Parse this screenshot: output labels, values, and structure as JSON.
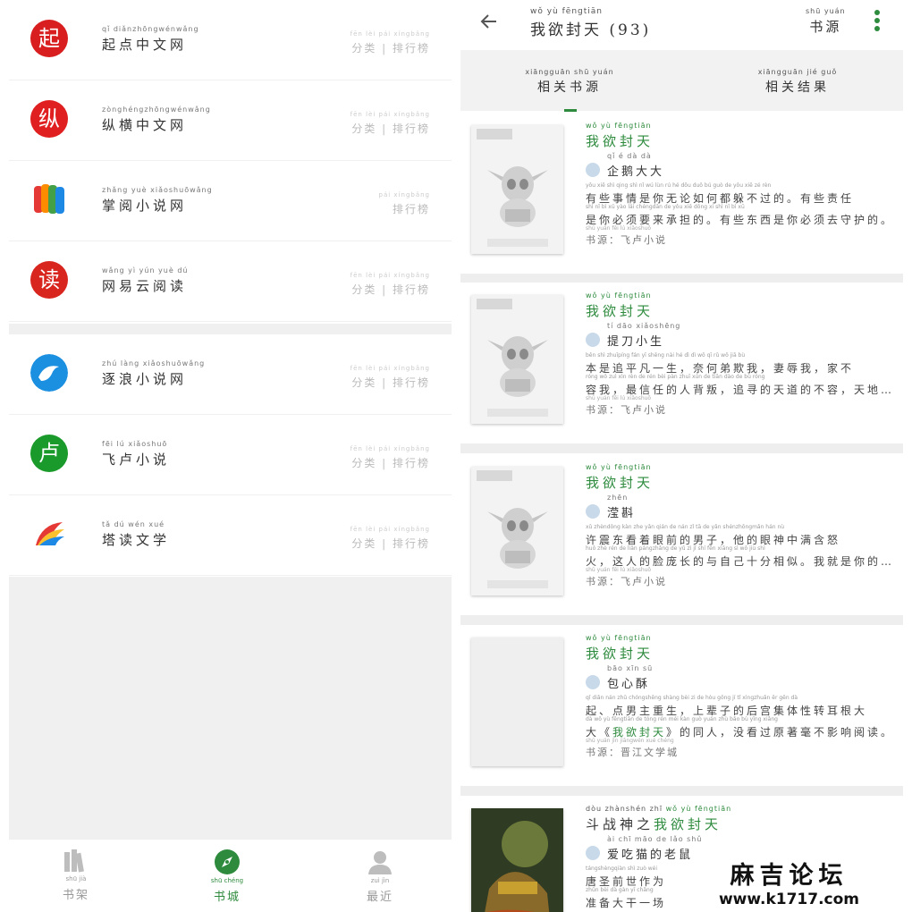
{
  "left": {
    "sources": [
      {
        "name_py": "qǐ diǎnzhōngwénwǎng",
        "name": "起点中文网",
        "links_py": "fēn lèi   pái xíngbǎng",
        "links": "分类 | 排行榜",
        "logo_color": "#d81e1e",
        "logo_glyph": "起",
        "icon": "qidian-logo-icon"
      },
      {
        "name_py": "zònghéngzhōngwénwǎng",
        "name": "纵横中文网",
        "links_py": "fēn lèi   pái xíngbǎng",
        "links": "分类 | 排行榜",
        "logo_color": "#e02020",
        "logo_glyph": "纵",
        "icon": "zongheng-logo-icon"
      },
      {
        "name_py": "zhǎng yuè xiǎoshuōwǎng",
        "name": "掌阅小说网",
        "links_py": "pái xíngbǎng",
        "links": "排行榜",
        "logo_color": "#f2b200",
        "logo_glyph": "",
        "icon": "zhangyue-logo-icon"
      },
      {
        "name_py": "wǎng yì yún yuè dú",
        "name": "网易云阅读",
        "links_py": "fēn lèi   pái xíngbǎng",
        "links": "分类 | 排行榜",
        "logo_color": "#d8261f",
        "logo_glyph": "读",
        "icon": "netease-read-logo-icon"
      },
      {
        "name_py": "zhú làng xiǎoshuōwǎng",
        "name": "逐浪小说网",
        "links_py": "fēn lèi   pái xíngbǎng",
        "links": "分类 | 排行榜",
        "logo_color": "#1b8fe0",
        "logo_glyph": "",
        "icon": "dolphin-logo-icon"
      },
      {
        "name_py": "fēi lú xiǎoshuō",
        "name": "飞卢小说",
        "links_py": "fēn lèi   pái xíngbǎng",
        "links": "分类 | 排行榜",
        "logo_color": "#1a9a2a",
        "logo_glyph": "卢",
        "icon": "feilu-logo-icon"
      },
      {
        "name_py": "tǎ dú wén xué",
        "name": "塔读文学",
        "links_py": "fēn lèi   pái xíngbǎng",
        "links": "分类 | 排行榜",
        "logo_color": "#f07f1a",
        "logo_glyph": "",
        "icon": "tadu-logo-icon"
      }
    ],
    "nav": [
      {
        "py": "shū jià",
        "label": "书架",
        "icon": "bookshelf-icon",
        "active": false
      },
      {
        "py": "shū chéng",
        "label": "书城",
        "icon": "compass-icon",
        "active": true
      },
      {
        "py": "zuì jìn",
        "label": "最近",
        "icon": "person-icon",
        "active": false
      }
    ]
  },
  "right": {
    "title_py": "wǒ yù fēngtiān",
    "title": "我欲封天 (93)",
    "source_py": "shū yuán",
    "source_label": "书源",
    "tabs": [
      {
        "py": "xiāngguān shū yuán",
        "label": "相关书源"
      },
      {
        "py": "xiāngguān jié guǒ",
        "label": "相关结果"
      }
    ],
    "results": [
      {
        "title_py": "wǒ yù fēngtiān",
        "title": "我欲封天",
        "author_py": "qǐ  é  dà  dà",
        "author": "企鹅大大",
        "intro_py1": "yǒu xiē shì qing shì nǐ wú lùn rú hé dōu duǒ bú guò de  yǒu xiē zé rèn",
        "intro1": "有些事情是你无论如何都躲不过的。有些责任",
        "intro_py2": "shì nǐ bì xū yào lái chéngdān de  yǒu xiē dōng xi shì nǐ bì xū",
        "intro2": "是你必须要来承担的。有些东西是你必须去守护的。",
        "origin_py": "shū yuán  fēi lú xiǎoshuō",
        "origin": "书源：飞卢小说",
        "cover": "feilu-placeholder"
      },
      {
        "title_py": "wǒ yù fēngtiān",
        "title": "我欲封天",
        "author_py": "tí dāo xiǎoshēng",
        "author": "提刀小生",
        "intro_py1": "běn shì zhuīpíng fán yī shēng  nài hé dì dì wǒ  qī rǔ wǒ  jiā bù",
        "intro1": "本是追平凡一生，奈何弟欺我，妻辱我，家不",
        "intro_py2": "róng wǒ  zuì xìn rèn de rén bèi pàn  zhuī xún de tiān dào de bù róng",
        "intro2": "容我，最信任的人背叛，追寻的天道的不容，天地不容！",
        "origin_py": "shū yuán  fēi lú xiǎoshuō",
        "origin": "书源：飞卢小说",
        "cover": "feilu-placeholder"
      },
      {
        "title_py": "wǒ yù fēngtiān",
        "title": "我欲封天",
        "author_py": "zhēn",
        "author": "滢斟",
        "intro_py1": "xǔ zhèndōng kàn zhe yǎn qián de nán zǐ  tā de yǎn shénzhōngmǎn hán nù",
        "intro1": "许震东看着眼前的男子，他的眼神中满含怒",
        "intro_py2": "huǒ  zhè rén de liǎn pángzhǎng de yǔ zì jǐ shí fēn xiāng sì  wǒ jiù shì",
        "intro2": "火，这人的脸庞长的与自己十分相似。我就是你的儿子。",
        "origin_py": "shū yuán  fēi lú xiǎoshuō",
        "origin": "书源：飞卢小说",
        "cover": "feilu-placeholder"
      },
      {
        "title_py": "wǒ yù fēngtiān",
        "title": "我欲封天",
        "author_py": "bāo xīn sū",
        "author": "包心酥",
        "intro_py1": "qǐ  diǎn nán zhǔ chóngshēng  shàng bèi zi de hòu gōng jí  tǐ xìngzhuǎn ěr gēn dà",
        "intro1": "起、点男主重生，上辈子的后宫集体性转耳根大",
        "intro_py2": "dà  wǒ yù fēngtiān  de tóng rén  méi kàn guò yuán zhù bǎo bù yǐng xiǎng",
        "intro2_a": "大《",
        "intro2_b": "我欲封天",
        "intro2_c": "》的同人，没看过原著毫不影响阅读。",
        "origin_py": "shū yuán  jìn jiāngwén xué chéng",
        "origin": "书源：晋江文学城",
        "cover": "blank"
      },
      {
        "title_py_a": "dòu zhànshén zhī",
        "title_a": "斗战神之",
        "title_py": "wǒ yù fēngtiān",
        "title": "我欲封天",
        "author_py": "ài chī māo de lǎo shǔ",
        "author": "爱吃猫的老鼠",
        "intro_py1": "tángshèngqiàn shì zuò wéi",
        "intro1": "唐圣前世作为",
        "intro_py2": "zhǔn bèi dà gàn yī chǎng",
        "intro2": "准备大干一场",
        "origin_py": "",
        "origin": "",
        "cover": "illustrated"
      }
    ]
  },
  "watermark": {
    "line1": "麻吉论坛",
    "line2": "www.k1717.com"
  },
  "colors": {
    "accent": "#2e8b3e",
    "band": "#eeeeee"
  }
}
